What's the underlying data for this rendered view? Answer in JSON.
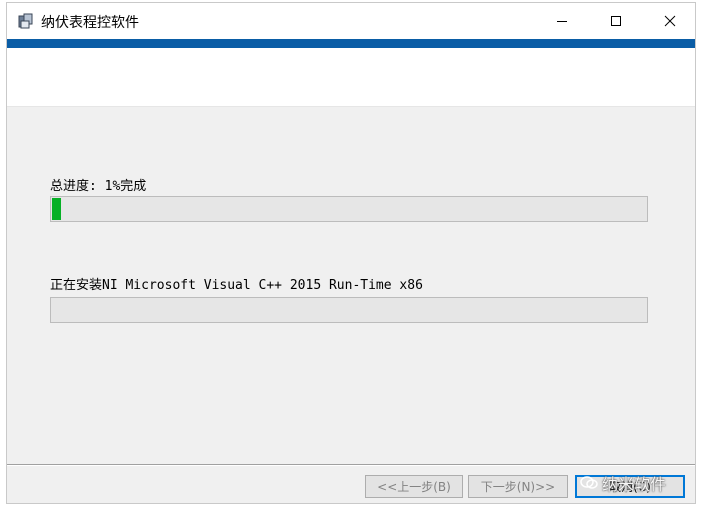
{
  "window": {
    "title": "纳伏表程控软件",
    "accent_color": "#0a5da6"
  },
  "titlebar_buttons": {
    "minimize_icon": "minimize-icon",
    "maximize_icon": "maximize-icon",
    "close_icon": "close-icon"
  },
  "progress": {
    "total_label": "总进度: 1%完成",
    "total_percent": 1,
    "current_label": "正在安装NI Microsoft Visual C++ 2015 Run-Time x86",
    "current_percent": 0,
    "fill_color": "#06b025"
  },
  "footer": {
    "back_label": "<<上一步(B)",
    "next_label": "下一步(N)>>",
    "cancel_label": "取消(C)"
  },
  "watermark": {
    "text": "纳米软件"
  }
}
